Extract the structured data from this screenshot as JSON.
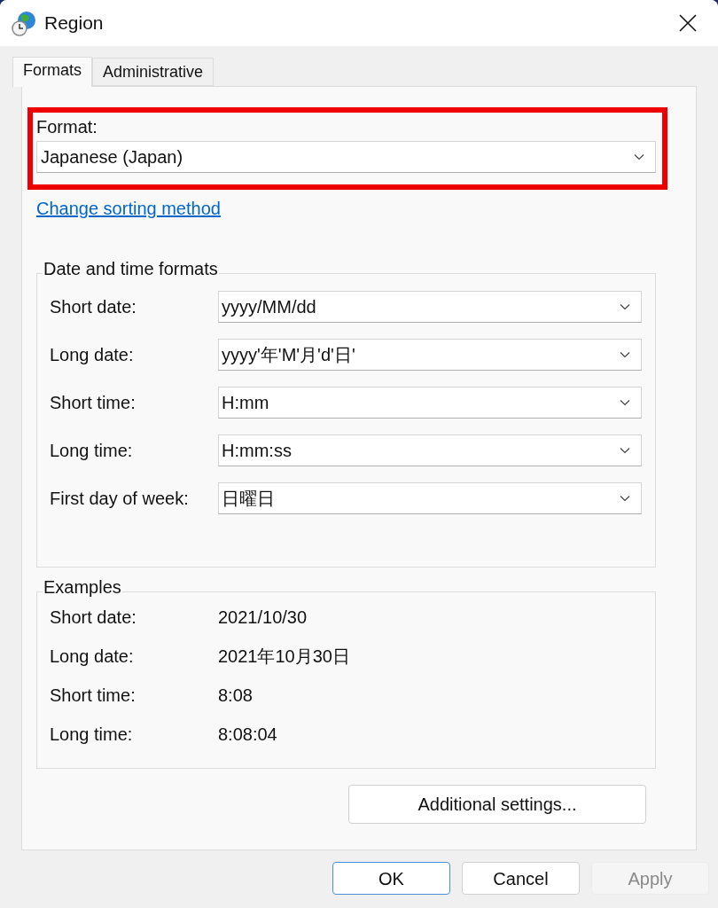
{
  "window": {
    "title": "Region"
  },
  "tabs": [
    {
      "label": "Formats",
      "selected": true
    },
    {
      "label": "Administrative",
      "selected": false
    }
  ],
  "format": {
    "label": "Format:",
    "value": "Japanese (Japan)",
    "highlighted": true
  },
  "sorting_link": "Change sorting method",
  "date_time_formats": {
    "title": "Date and time formats",
    "rows": [
      {
        "label": "Short date:",
        "value": "yyyy/MM/dd"
      },
      {
        "label": "Long date:",
        "value": "yyyy'年'M'月'd'日'"
      },
      {
        "label": "Short time:",
        "value": "H:mm"
      },
      {
        "label": "Long time:",
        "value": "H:mm:ss"
      },
      {
        "label": "First day of week:",
        "value": "日曜日"
      }
    ]
  },
  "examples": {
    "title": "Examples",
    "rows": [
      {
        "label": "Short date:",
        "value": "2021/10/30"
      },
      {
        "label": "Long date:",
        "value": "2021年10月30日"
      },
      {
        "label": "Short time:",
        "value": "8:08"
      },
      {
        "label": "Long time:",
        "value": "8:08:04"
      }
    ]
  },
  "additional_settings": "Additional settings...",
  "buttons": [
    {
      "label": "OK",
      "default": true,
      "disabled": false
    },
    {
      "label": "Cancel",
      "default": false,
      "disabled": false
    },
    {
      "label": "Apply",
      "default": false,
      "disabled": true
    }
  ]
}
